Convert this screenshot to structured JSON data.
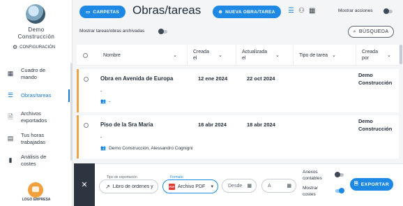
{
  "sidebar": {
    "company_line1": "Demo",
    "company_line2": "Construcción",
    "config_label": "CONFIGURACIÓN",
    "items": [
      {
        "label": "Cuadro de mando",
        "icon": "dashboard-icon"
      },
      {
        "label": "Obras/tareas",
        "icon": "list-icon",
        "active": true
      },
      {
        "label": "Archivos exportados",
        "icon": "export-file-icon"
      },
      {
        "label": "Tus horas trabajadas",
        "icon": "calendar-icon"
      },
      {
        "label": "Análisis de costes",
        "icon": "bar-chart-icon"
      }
    ],
    "logo_text": "LOGO EMPRESA"
  },
  "header": {
    "carpetas_label": "CARPETAS",
    "title": "Obras/tareas",
    "new_label": "NUEVA OBRA/TAREA",
    "show_actions_label": "Mostrar acciones",
    "show_actions_on": false,
    "show_archived_label": "Mostrar tareas/obras archivadas",
    "show_archived_on": false,
    "search_label": "BÚSQUEDA"
  },
  "table": {
    "columns": [
      "Nombre",
      "Creada el",
      "Actualizada el",
      "Tipo de tarea",
      "Creada por"
    ],
    "rows": [
      {
        "name": "Obra en Avenida de Europa",
        "created": "12 ene 2024",
        "updated": "22 oct 2024",
        "type": "",
        "creator": "Demo Construcción",
        "dash": "-",
        "members": "-"
      },
      {
        "name": "Piso de la Sra María",
        "created": "18 abr 2024",
        "updated": "18 abr 2024",
        "type": "",
        "creator": "Demo Construcción",
        "dash": "-",
        "members": "Demo Construcción, Alessandro Cognigni"
      }
    ]
  },
  "export": {
    "type_caption": "Tipo de exportación",
    "type_value": "Libro de órdenes y",
    "format_caption": "Formato",
    "format_value": "Archivo PDF",
    "from_placeholder": "Desde",
    "to_placeholder": "A",
    "annex_label": "Anexos contables",
    "annex_on": false,
    "costs_label": "Mostrar costes",
    "costs_on": true,
    "export_label": "EXPORTAR"
  },
  "colors": {
    "accent": "#1e88e5",
    "row_marker": "#f0a24b"
  }
}
